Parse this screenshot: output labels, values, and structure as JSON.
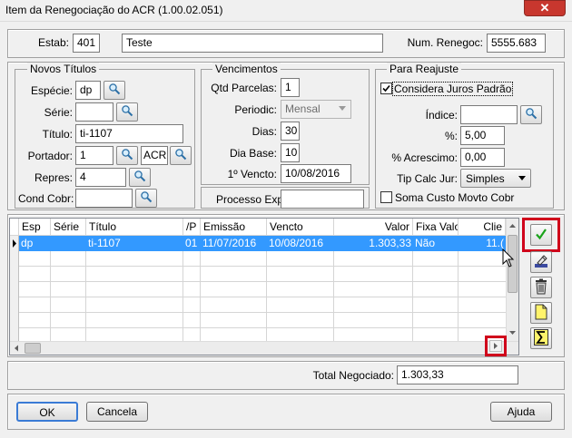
{
  "window": {
    "title": "Item da Renegociação do ACR (1.00.02.051)",
    "close_glyph": "✕"
  },
  "top": {
    "estab_label": "Estab:",
    "estab_value": "401",
    "estab_desc": "Teste",
    "num_label": "Num. Renegoc:",
    "num_value": "5555.683"
  },
  "novos": {
    "group_label": "Novos Títulos",
    "especie_label": "Espécie:",
    "especie_value": "dp",
    "serie_label": "Série:",
    "serie_value": "",
    "titulo_label": "Título:",
    "titulo_value": "ti-1107",
    "portador_label": "Portador:",
    "portador_value": "1",
    "portador_code": "ACR",
    "repres_label": "Repres:",
    "repres_value": "4",
    "cond_label": "Cond Cobr:",
    "cond_value": ""
  },
  "venc": {
    "group_label": "Vencimentos",
    "qtd_label": "Qtd Parcelas:",
    "qtd_value": "1",
    "periodic_label": "Periodic:",
    "periodic_value": "Mensal",
    "dias_label": "Dias:",
    "dias_value": "30",
    "diabase_label": "Dia Base:",
    "diabase_value": "10",
    "primeiro_label": "1º Vencto:",
    "primeiro_value": "10/08/2016",
    "processo_label": "Processo Exp:",
    "processo_value": ""
  },
  "reajuste": {
    "group_label": "Para Reajuste",
    "juros_label": "Considera Juros Padrão",
    "juros_checked": true,
    "indice_label": "Índice:",
    "indice_value": "",
    "pct_label": "%:",
    "pct_value": "5,00",
    "acresc_label": "% Acrescimo:",
    "acresc_value": "0,00",
    "tipcalc_label": "Tip Calc Jur:",
    "tipcalc_value": "Simples",
    "soma_label": "Soma Custo Movto Cobr",
    "soma_checked": false
  },
  "grid": {
    "headers": [
      "Esp",
      "Série",
      "Título",
      "/P",
      "Emissão",
      "Vencto",
      "Valor",
      "Fixa Valor",
      "Clie"
    ],
    "row": {
      "esp": "dp",
      "serie": "",
      "titulo": "ti-1107",
      "p": "01",
      "emissao": "11/07/2016",
      "vencto": "10/08/2016",
      "valor": "1.303,33",
      "fixa": "Não",
      "clie": "11.("
    }
  },
  "side_buttons": [
    "check-icon",
    "edit-icon",
    "trash-icon",
    "new-doc-icon",
    "sum-icon"
  ],
  "total": {
    "label": "Total Negociado:",
    "value": "1.303,33"
  },
  "footer": {
    "ok": "OK",
    "cancel": "Cancela",
    "help": "Ajuda"
  },
  "colors": {
    "selection": "#3399ff",
    "highlight": "#d0021b",
    "check": "#1aa31a"
  }
}
